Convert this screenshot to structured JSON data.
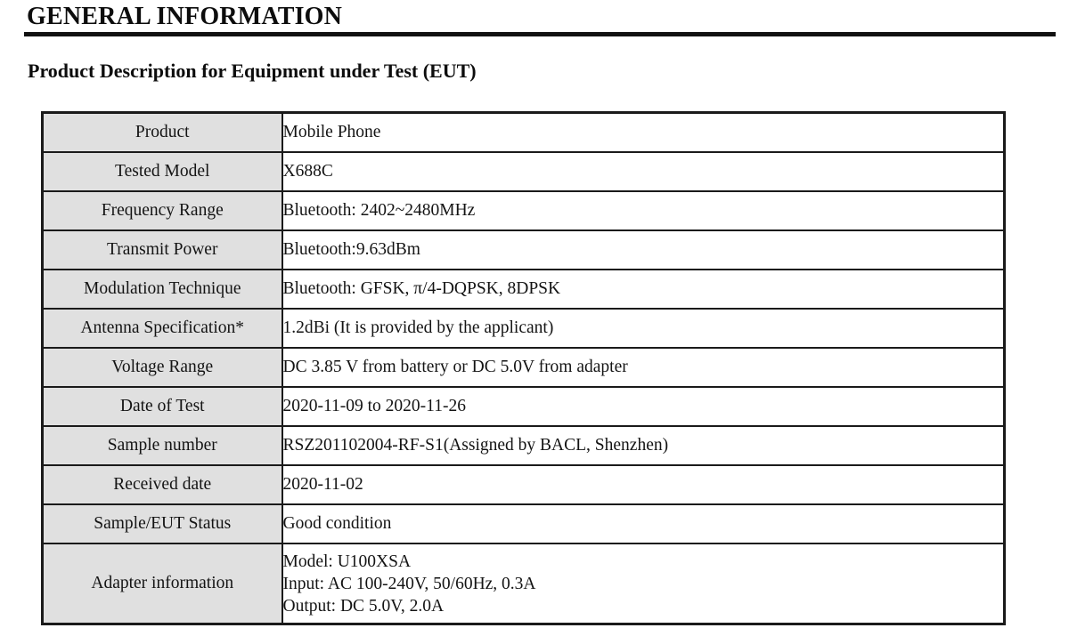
{
  "document": {
    "section_heading": "GENERAL INFORMATION",
    "sub_heading": "Product Description for Equipment under Test (EUT)"
  },
  "colors": {
    "label_cell_background": "#e0e0e0",
    "value_cell_background": "#ffffff",
    "border": "#1a1a1a",
    "text": "#141414",
    "rule": "#111111"
  },
  "spec_table": {
    "rows": [
      {
        "label": "Product",
        "value": "Mobile Phone"
      },
      {
        "label": "Tested Model",
        "value": "X688C"
      },
      {
        "label": "Frequency Range",
        "value": "Bluetooth: 2402~2480MHz"
      },
      {
        "label": "Transmit Power",
        "value": "Bluetooth:9.63dBm"
      },
      {
        "label": "Modulation Technique",
        "value": "Bluetooth: GFSK, π/4-DQPSK, 8DPSK"
      },
      {
        "label": "Antenna Specification*",
        "value": "1.2dBi (It is provided by the applicant)"
      },
      {
        "label": "Voltage Range",
        "value": "DC 3.85 V from battery or DC 5.0V from adapter"
      },
      {
        "label": "Date of Test",
        "value": "2020-11-09 to 2020-11-26"
      },
      {
        "label": "Sample number",
        "value": "RSZ201102004-RF-S1(Assigned by BACL, Shenzhen)"
      },
      {
        "label": "Received date",
        "value": "2020-11-02"
      },
      {
        "label": "Sample/EUT Status",
        "value": "Good condition"
      }
    ],
    "adapter_row": {
      "label": "Adapter information",
      "lines": [
        "Model: U100XSA",
        "Input: AC 100-240V, 50/60Hz, 0.3A",
        "Output: DC 5.0V, 2.0A"
      ]
    }
  }
}
